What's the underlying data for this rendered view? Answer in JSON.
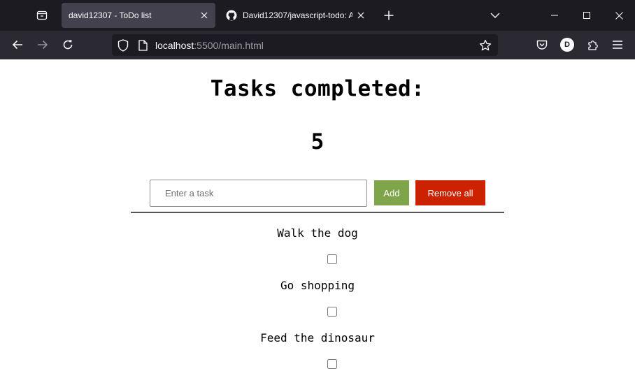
{
  "browser": {
    "tabs": [
      {
        "title": "david12307 - ToDo list",
        "active": true,
        "favicon": "none"
      },
      {
        "title": "David12307/javascript-todo: A s",
        "active": false,
        "favicon": "github-icon"
      }
    ],
    "url": {
      "host": "localhost",
      "rest": ":5500/main.html"
    },
    "account_initial": "D"
  },
  "page": {
    "title": "Tasks completed:",
    "completed_count": "5",
    "input_placeholder": "Enter a task",
    "add_label": "Add",
    "remove_all_label": "Remove all",
    "tasks": [
      {
        "label": "Walk the dog",
        "checked": false
      },
      {
        "label": "Go shopping",
        "checked": false
      },
      {
        "label": "Feed the dinosaur",
        "checked": false
      }
    ]
  },
  "colors": {
    "add_button": "#7ea54a",
    "remove_button": "#cc2200",
    "browser_chrome": "#1c1b22",
    "toolbar": "#2b2a33"
  }
}
